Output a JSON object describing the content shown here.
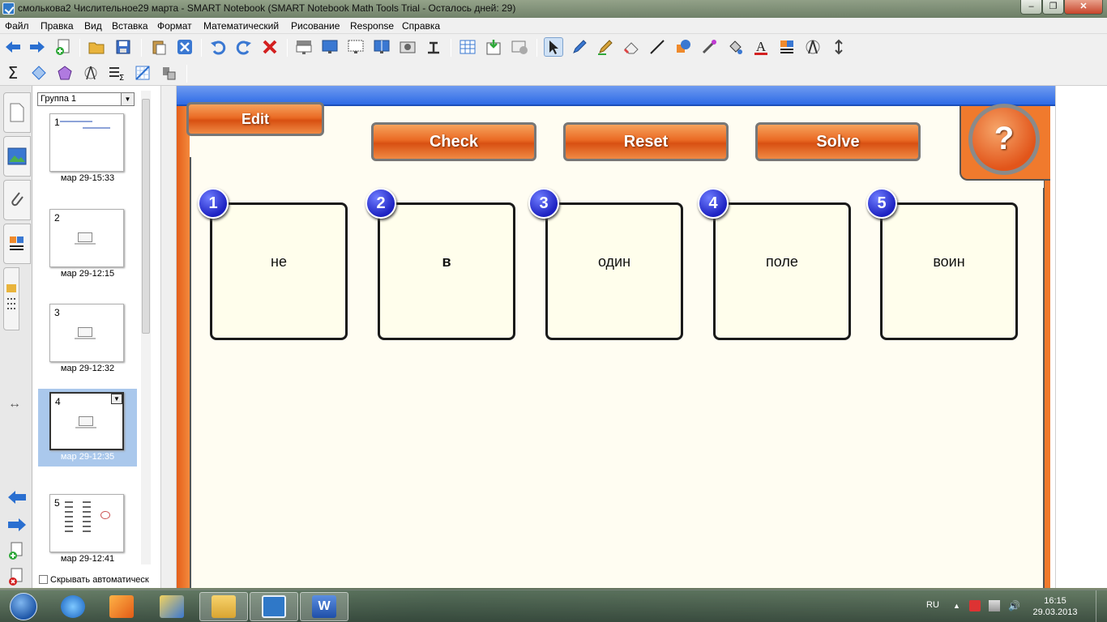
{
  "window": {
    "title": "смолькова2 Числительное29 марта - SMART Notebook (SMART Notebook Math Tools Trial - Осталось дней: 29)",
    "min_label": "‒",
    "max_label": "❐",
    "close_label": "✕"
  },
  "menu": [
    "Файл",
    "Правка",
    "Вид",
    "Вставка",
    "Формат",
    "Математический",
    "Рисование",
    "Response",
    "Справка"
  ],
  "toolbar1": [
    "back-icon",
    "forward-icon",
    "add-page-icon",
    "open-folder-icon",
    "save-icon",
    "paste-icon",
    "delete-page-icon",
    "undo-icon",
    "redo-icon",
    "delete-icon",
    "screen-shade-icon",
    "full-screen-icon",
    "transparent-background-icon",
    "dual-display-icon",
    "screen-capture-icon",
    "document-camera-icon",
    "table-icon",
    "insert-icon",
    "record-icon",
    "select-icon",
    "pen-icon",
    "creative-pen-icon",
    "eraser-icon",
    "line-icon",
    "shapes-icon",
    "magic-pen-icon",
    "fill-icon",
    "text-icon",
    "properties-icon",
    "compass-icon",
    "more-icon"
  ],
  "toolbar2": [
    "sigma-icon",
    "geometry-icon",
    "polygon-icon",
    "measure-icon",
    "table-math-icon",
    "graph-icon",
    "math-tools-icon"
  ],
  "sorter": {
    "group": "Группа 1",
    "pages": [
      {
        "num": "1",
        "time": "мар 29-15:33"
      },
      {
        "num": "2",
        "time": "мар 29-12:15"
      },
      {
        "num": "3",
        "time": "мар 29-12:32"
      },
      {
        "num": "4",
        "time": "мар 29-12:35"
      },
      {
        "num": "5",
        "time": "мар 29-12:41"
      }
    ],
    "selected_page": "4",
    "autohide_label": "Скрывать автоматическ"
  },
  "activity": {
    "edit_label": "Edit",
    "check_label": "Check",
    "reset_label": "Reset",
    "solve_label": "Solve",
    "help_label": "?",
    "cards": [
      {
        "num": "1",
        "word": "не"
      },
      {
        "num": "2",
        "word": "в"
      },
      {
        "num": "3",
        "word": "один"
      },
      {
        "num": "4",
        "word": "поле"
      },
      {
        "num": "5",
        "word": "воин"
      }
    ]
  },
  "taskbar": {
    "apps": [
      "internet-explorer-icon",
      "media-player-icon",
      "paint-icon",
      "explorer-icon",
      "smart-notebook-icon",
      "word-icon"
    ],
    "active_app": "smart-notebook-icon",
    "lang": "RU",
    "time": "16:15",
    "date": "29.03.2013"
  },
  "colors": {
    "accent_orange": "#f07a2d",
    "badge_blue": "#1d22c2",
    "title_blue": "#2e6be6"
  }
}
